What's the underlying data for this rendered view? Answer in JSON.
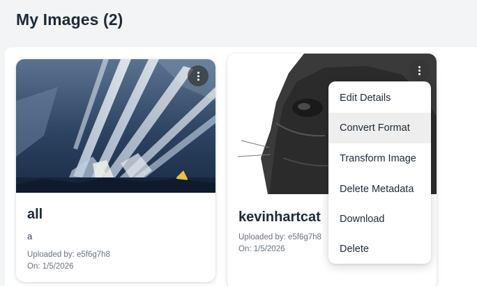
{
  "page": {
    "title": "My Images (2)"
  },
  "images": [
    {
      "title": "all",
      "description": "a",
      "uploaded_by": "Uploaded by: e5f6g7h8",
      "date": "On: 1/5/2026"
    },
    {
      "title": "kevinhartcat",
      "uploaded_by": "Uploaded by: e5f6g7h8",
      "date": "On: 1/5/2026"
    }
  ],
  "context_menu": {
    "items": [
      "Edit Details",
      "Convert Format",
      "Transform Image",
      "Delete Metadata",
      "Download",
      "Delete"
    ],
    "highlighted": "Convert Format"
  }
}
